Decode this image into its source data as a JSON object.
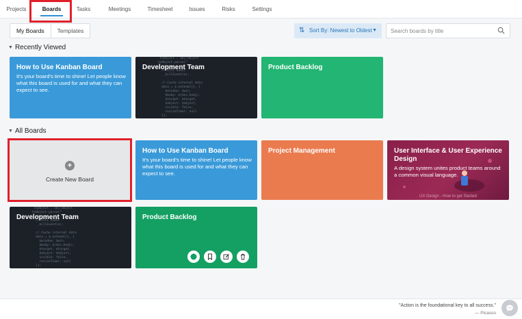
{
  "nav": {
    "tabs": [
      "Projects",
      "Boards",
      "Tasks",
      "Meetings",
      "Timesheet",
      "Issues",
      "Risks",
      "Settings"
    ],
    "active": "Boards"
  },
  "subtabs": [
    "My Boards",
    "Templates"
  ],
  "sort": {
    "label": "Sort By: Newest to Oldest"
  },
  "search": {
    "placeholder": "Search boards by title"
  },
  "sections": {
    "recent": "Recently Viewed",
    "all": "All Boards"
  },
  "recent": [
    {
      "title": "How to Use Kanban Board",
      "desc": "It's your board's time to shine! Let people know what this board is used for and what they can expect to see.",
      "color": "#3a9ad9"
    },
    {
      "title": "Development Team",
      "desc": "",
      "color": "#1c2128"
    },
    {
      "title": "Product Backlog",
      "desc": "",
      "color": "#22b573"
    }
  ],
  "create": {
    "label": "Create New Board"
  },
  "all": [
    {
      "title": "How to Use Kanban Board",
      "desc": "It's your board's time to shine! Let people know what this board is used for and what they can expect to see.",
      "color": "#3a9ad9"
    },
    {
      "title": "Project Management",
      "desc": "",
      "color": "#ea7b4f"
    },
    {
      "title": "User Interface & User Experience Design",
      "desc": "A design system unites product teams around a common visual language.",
      "color": "#8a1f4a",
      "caption": "UX Design - How to get Started"
    },
    {
      "title": "Development Team",
      "desc": "",
      "color": "#1c2128"
    },
    {
      "title": "Product Backlog",
      "desc": "",
      "color": "#14a063"
    }
  ],
  "footer": {
    "quote": "\"Action is the foundational key to all success.\"",
    "author": "— Picasso"
  },
  "icons": {
    "sort": "sort-icon",
    "search": "search-icon",
    "create": "plus-icon",
    "actions": [
      "circle-icon",
      "bookmark-icon",
      "edit-icon",
      "trash-icon"
    ],
    "chat": "chat-icon"
  }
}
